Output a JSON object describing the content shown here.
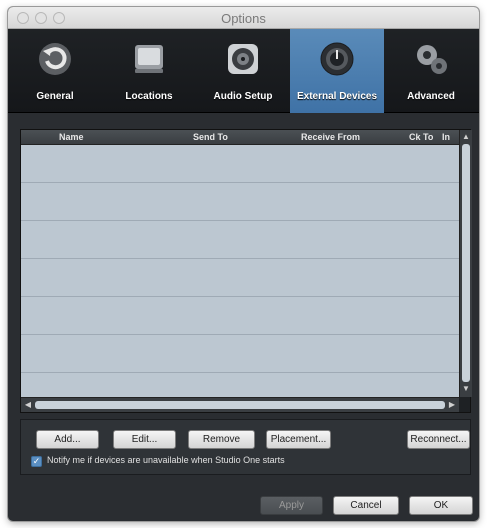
{
  "window": {
    "title": "Options"
  },
  "toolbar": {
    "items": [
      {
        "label": "General",
        "icon": "general-icon"
      },
      {
        "label": "Locations",
        "icon": "locations-icon"
      },
      {
        "label": "Audio Setup",
        "icon": "audio-setup-icon"
      },
      {
        "label": "External Devices",
        "icon": "external-devices-icon",
        "active": true
      },
      {
        "label": "Advanced",
        "icon": "advanced-icon"
      }
    ],
    "active_color": "#4a7fb3"
  },
  "table": {
    "columns": [
      "Name",
      "Send To",
      "Receive From",
      "Ck To",
      "In"
    ],
    "rows": []
  },
  "buttons": {
    "add": "Add...",
    "edit": "Edit...",
    "remove": "Remove",
    "placement": "Placement...",
    "reconnect": "Reconnect..."
  },
  "notify": {
    "label": "Notify me if devices are unavailable when Studio One starts",
    "checked": true
  },
  "footer": {
    "apply": "Apply",
    "cancel": "Cancel",
    "ok": "OK"
  }
}
